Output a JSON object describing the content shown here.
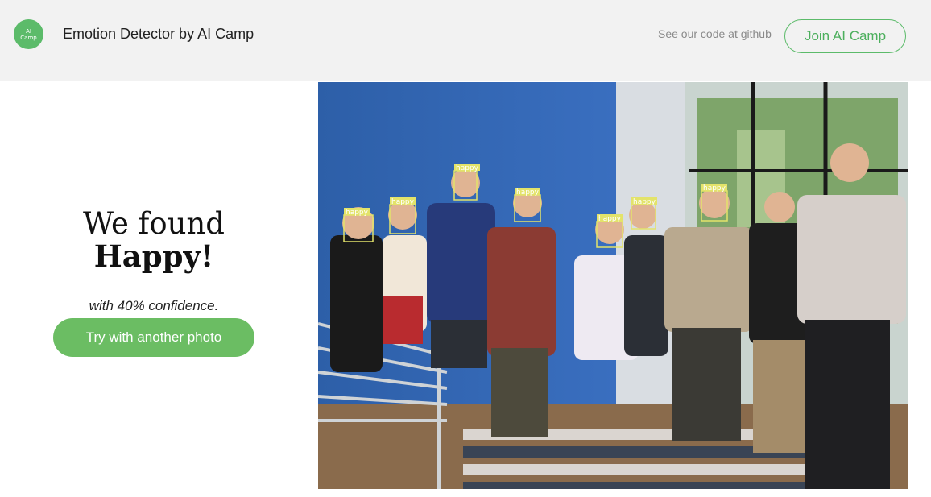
{
  "header": {
    "logo_text": [
      "AI",
      "Camp"
    ],
    "app_title": "Emotion Detector by AI Camp",
    "github_link": "See our code at github",
    "join_button": "Join AI Camp"
  },
  "result": {
    "line1": "We found",
    "emotion": "Happy!",
    "confidence_text": "with 40% confidence.",
    "try_button": "Try with another photo"
  },
  "photo": {
    "face_labels": [
      "happy",
      "happy",
      "happy",
      "happy",
      "happy",
      "happy",
      "happy"
    ],
    "box_color": "#e3e36a"
  },
  "colors": {
    "accent": "#5cbb6a",
    "header_bg": "#f2f2f2"
  }
}
